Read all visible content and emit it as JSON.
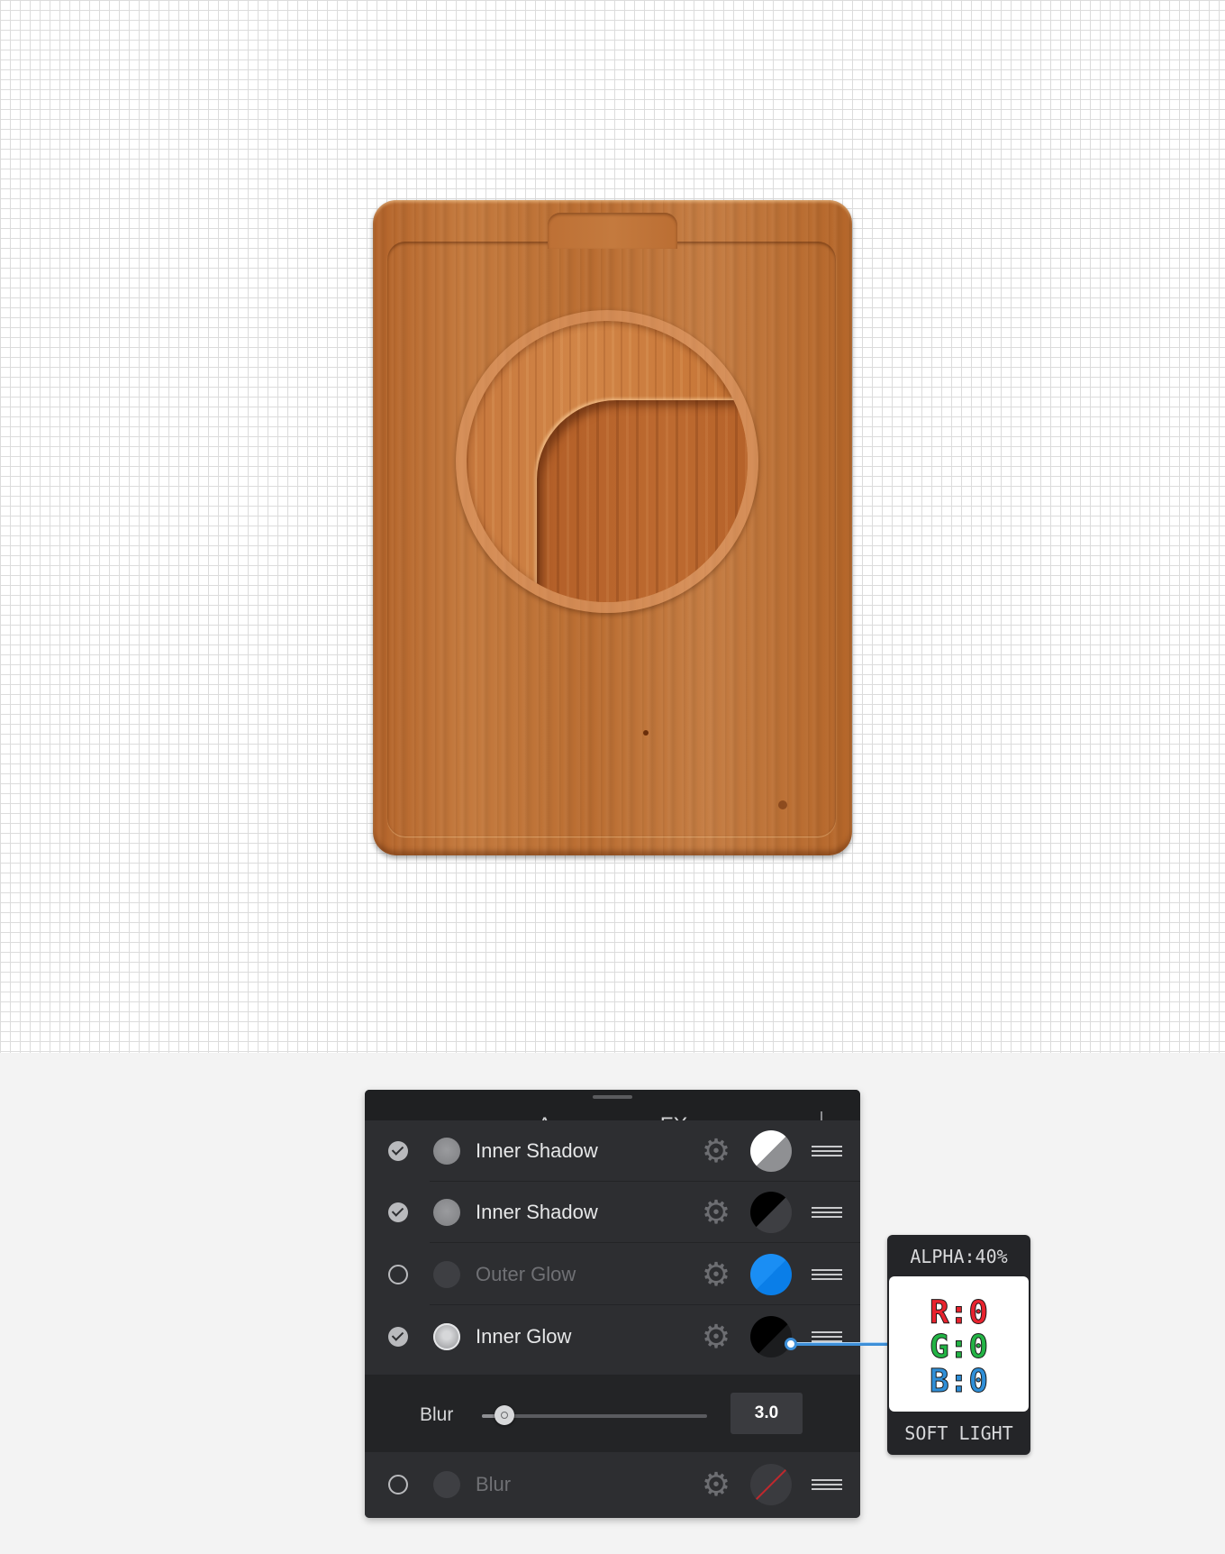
{
  "panel": {
    "title": "Appearance FX",
    "effects": [
      {
        "name": "Inner Shadow",
        "enabled": true,
        "swatch": "white-grey"
      },
      {
        "name": "Inner Shadow",
        "enabled": true,
        "swatch": "black-grey"
      },
      {
        "name": "Outer Glow",
        "enabled": false,
        "swatch": "blue",
        "color": "#0a7ee8"
      },
      {
        "name": "Inner Glow",
        "enabled": true,
        "swatch": "black",
        "color": "#000000"
      }
    ],
    "blur_setting": {
      "label": "Blur",
      "value": "3.0",
      "slider_fraction": 0.1
    },
    "blur_effect": {
      "name": "Blur",
      "enabled": false,
      "swatch": "none"
    }
  },
  "color_callout": {
    "alpha": "ALPHA:40%",
    "r": "R:0",
    "g": "G:0",
    "b": "B:0",
    "blend_mode": "SOFT LIGHT"
  },
  "icons": [
    "check-icon",
    "gear-icon",
    "drag-handle-icon",
    "add-icon"
  ]
}
